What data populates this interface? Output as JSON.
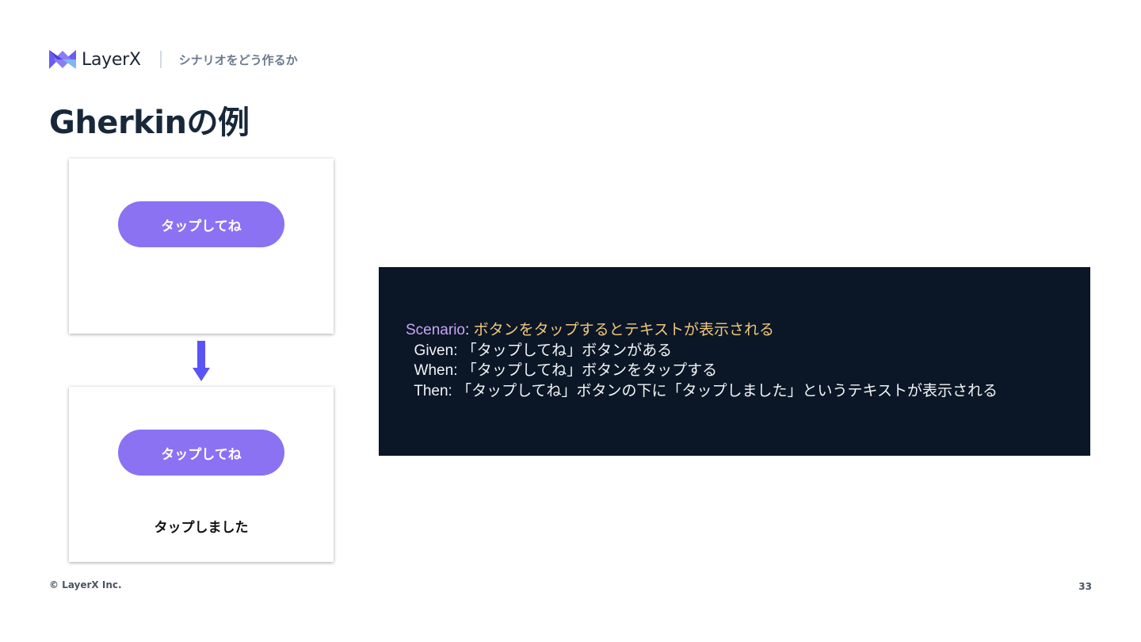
{
  "header": {
    "brand": "LayerX",
    "section": "シナリオをどう作るか"
  },
  "slide": {
    "title": "Gherkinの例"
  },
  "mockups": {
    "before": {
      "button_label": "タップしてね"
    },
    "after": {
      "button_label": "タップしてね",
      "result_text": "タップしました"
    }
  },
  "code": {
    "scenario_keyword": "Scenario",
    "scenario_sep": ": ",
    "scenario_title": "ボタンをタップするとテキストが表示される",
    "given": "  Given: 「タップしてね」ボタンがある",
    "when": "  When: 「タップしてね」ボタンをタップする",
    "then": "  Then: 「タップしてね」ボタンの下に「タップしました」というテキストが表示される"
  },
  "footer": {
    "copyright": "© LayerX Inc.",
    "page_number": "33"
  },
  "colors": {
    "accent": "#8a72f3",
    "arrow": "#5b54f4",
    "code_bg": "#0b1726",
    "code_keyword": "#c9a3f5",
    "code_title": "#f1c77c"
  }
}
